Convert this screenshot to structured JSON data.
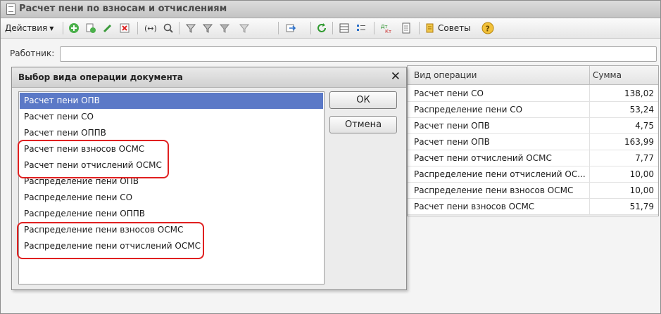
{
  "window": {
    "title": "Расчет пени по взносам и отчислениям"
  },
  "toolbar": {
    "actions_label": "Действия",
    "tips_label": "Советы",
    "icons": [
      "add-icon",
      "copy-icon",
      "edit-icon",
      "delete-icon",
      "move-icon",
      "search-icon",
      "filter-icon",
      "filter-list-icon",
      "filter-select-icon",
      "filter-clear-icon",
      "go-to-icon",
      "refresh-icon",
      "grid-icon",
      "list-icon",
      "dt-kt-icon",
      "report-icon",
      "tips-icon",
      "help-icon"
    ]
  },
  "worker": {
    "label": "Работник:",
    "value": ""
  },
  "table": {
    "columns": [
      "Вид операции",
      "Сумма"
    ],
    "rows": [
      {
        "op": "Расчет пени СО",
        "sum": "138,02"
      },
      {
        "op": "Распределение пени СО",
        "sum": "53,24"
      },
      {
        "op": "Расчет пени ОПВ",
        "sum": "4,75"
      },
      {
        "op": "Расчет пени ОПВ",
        "sum": "163,99"
      },
      {
        "op": "Расчет пени отчислений ОСМС",
        "sum": "7,77"
      },
      {
        "op": "Распределение пени отчислений ОС...",
        "sum": "10,00"
      },
      {
        "op": "Распределение пени взносов ОСМС",
        "sum": "10,00"
      },
      {
        "op": "Расчет пени взносов ОСМС",
        "sum": "51,79"
      }
    ]
  },
  "dialog": {
    "title": "Выбор вида операции документа",
    "ok_label": "ОК",
    "cancel_label": "Отмена",
    "items": [
      "Расчет пени ОПВ",
      "Расчет пени СО",
      "Расчет пени ОППВ",
      "Расчет пени взносов ОСМС",
      "Расчет пени отчислений ОСМС",
      "Распределение пени ОПВ",
      "Распределение пени СО",
      "Распределение пени ОППВ",
      "Распределение пени взносов ОСМС",
      "Распределение пени отчислений ОСМС"
    ],
    "selected_index": 0
  },
  "colors": {
    "selection": "#5b79c7",
    "annotation": "#e02020"
  }
}
